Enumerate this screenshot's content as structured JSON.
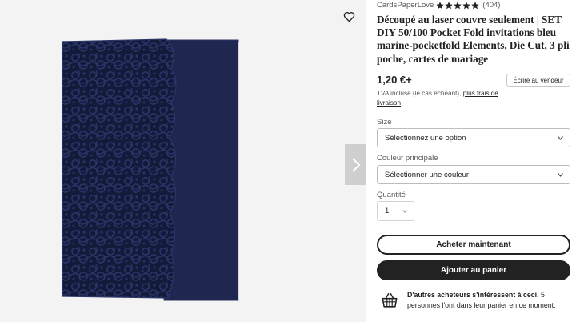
{
  "listing": {
    "shop_name": "CardsPaperLove",
    "rating_stars": 5,
    "review_count": "(404)",
    "title": "Découpé au laser couvre seulement | SET DIY 50/100 Pocket Fold invitations bleu marine-pocketfold Elements, Die Cut, 3 pli poche, cartes de mariage",
    "price": "1,20 €+",
    "contact_label": "Écrire au vendeur",
    "tax_note": "TVA incluse (le cas échéant),",
    "shipping_link": "plus frais de livraison"
  },
  "options": {
    "size_label": "Size",
    "size_value": "Sélectionnez une option",
    "color_label": "Couleur principale",
    "color_value": "Sélectionner une couleur",
    "quantity_label": "Quantité",
    "quantity_value": "1"
  },
  "actions": {
    "buy_now": "Acheter maintenant",
    "add_to_cart": "Ajouter au panier"
  },
  "social_proof": {
    "bold_text": "D'autres acheteurs s'intéressent à ceci.",
    "rest_text": " 5 personnes l'ont dans leur panier en ce moment."
  },
  "icons": {
    "favorite": "heart-outline-icon",
    "next": "chevron-right-icon",
    "star": "star-icon",
    "basket": "basket-icon"
  },
  "colors": {
    "card_navy": "#232b55",
    "button_dark": "#222222",
    "star": "#222222"
  }
}
